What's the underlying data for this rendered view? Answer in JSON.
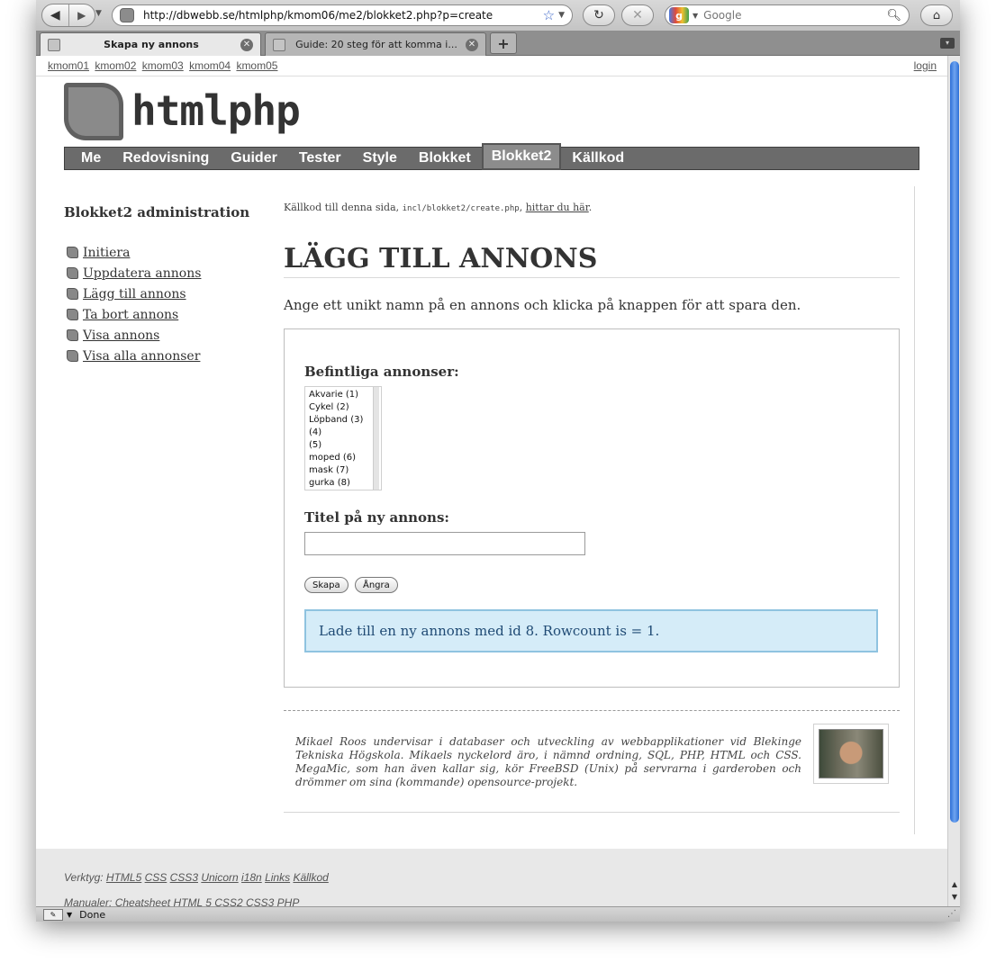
{
  "browser": {
    "url": "http://dbwebb.se/htmlphp/kmom06/me2/blokket2.php?p=create",
    "search_placeholder": "Google",
    "tabs": [
      {
        "label": "Skapa ny annons"
      },
      {
        "label": "Guide: 20 steg för att komma i..."
      }
    ],
    "status": "Done"
  },
  "site": {
    "topnav": [
      "kmom01",
      "kmom02",
      "kmom03",
      "kmom04",
      "kmom05"
    ],
    "login": "login",
    "logo_text": "htmlphp",
    "mainnav": [
      "Me",
      "Redovisning",
      "Guider",
      "Tester",
      "Style",
      "Blokket",
      "Blokket2",
      "Källkod"
    ],
    "mainnav_active": "Blokket2"
  },
  "sidebar": {
    "title": "Blokket2 administration",
    "items": [
      {
        "label": "Initiera"
      },
      {
        "label": "Uppdatera annons"
      },
      {
        "label": "Lägg till annons"
      },
      {
        "label": "Ta bort annons"
      },
      {
        "label": "Visa annons"
      },
      {
        "label": "Visa alla annonser"
      }
    ]
  },
  "content": {
    "source_prefix": "Källkod till denna sida, ",
    "source_file": "incl/blokket2/create.php",
    "source_sep": ", ",
    "source_link": "hittar du här",
    "source_suffix": ".",
    "heading": "LÄGG TILL ANNONS",
    "intro": "Ange ett unikt namn på en annons och klicka på knappen för att spara den.",
    "existing_label": "Befintliga annonser:",
    "existing_ads": [
      "Akvarie (1)",
      "Cykel (2)",
      "Löpband (3)",
      "(4)",
      "(5)",
      "moped (6)",
      "mask (7)",
      "gurka (8)"
    ],
    "title_label": "Titel på ny annons:",
    "title_value": "",
    "create_button": "Skapa",
    "undo_button": "Ångra",
    "message": "Lade till en ny annons med id 8. Rowcount is = 1."
  },
  "bio": {
    "text": "Mikael Roos undervisar i databaser och utveckling av webbapplikationer vid Blekinge Tekniska Högskola. Mikaels nyckelord äro, i nämnd ordning, SQL, PHP, HTML och CSS. MegaMic, som han även kallar sig, kör FreeBSD (Unix) på servrarna i garderoben och drömmer om sina (kommande) opensource-projekt."
  },
  "footer": {
    "tools_label": "Verktyg:",
    "tools": [
      "HTML5",
      "CSS",
      "CSS3",
      "Unicorn",
      "i18n",
      "Links",
      "Källkod"
    ],
    "manuals_label": "Manualer:",
    "manuals": [
      "Cheatsheet",
      "HTML 5",
      "CSS2",
      "CSS3",
      "PHP"
    ]
  }
}
